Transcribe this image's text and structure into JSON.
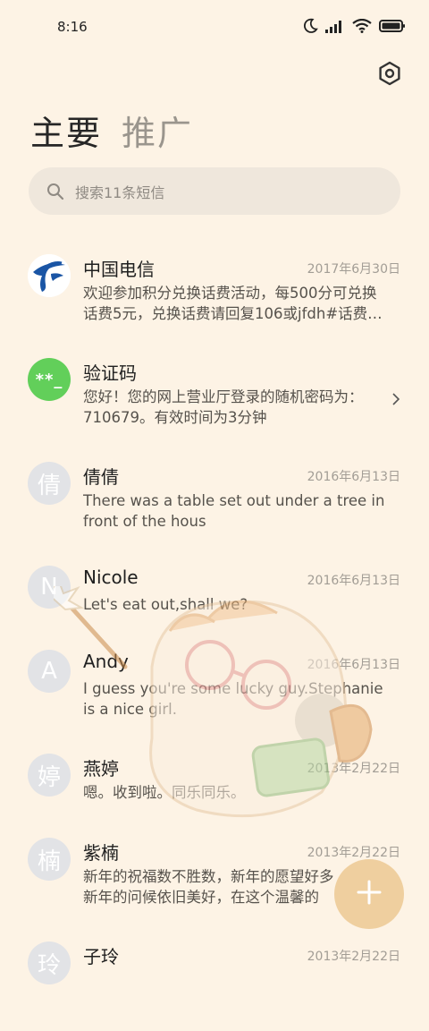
{
  "status_bar": {
    "time": "8:16",
    "icons": [
      "moon-icon",
      "signal-icon",
      "wifi-icon",
      "battery-icon"
    ]
  },
  "header": {
    "settings_icon": "settings-icon",
    "tabs": [
      {
        "label": "主要",
        "active": true
      },
      {
        "label": "推广",
        "active": false
      }
    ]
  },
  "search": {
    "placeholder": "搜索11条短信",
    "icon": "search-icon"
  },
  "conversations": [
    {
      "name": "中国电信",
      "date": "2017年6月30日",
      "message": "欢迎参加积分兑换话费活动，每500分可兑换\n话费5元，兑换话费请回复106或jfdh#话费…",
      "avatar": "telecom-logo"
    },
    {
      "name": "验证码",
      "date": "",
      "message": "您好！您的网上营业厅登录的随机密码为：\n710679。有效时间为3分钟",
      "avatar_text": "**_",
      "has_chevron": true
    },
    {
      "name": "倩倩",
      "date": "2016年6月13日",
      "message": "There was a table set out under a tree in\nfront of the hous",
      "avatar_text": "倩"
    },
    {
      "name": "Nicole",
      "date": "2016年6月13日",
      "message": "Let's eat out,shall we?",
      "avatar_text": "N"
    },
    {
      "name": "Andy",
      "date": "2016年6月13日",
      "message": "I guess you're some lucky guy.Stephanie\nis a nice girl.",
      "avatar_text": "A"
    },
    {
      "name": "燕婷",
      "date": "2013年2月22日",
      "message": "嗯。收到啦。同乐同乐。",
      "avatar_text": "婷"
    },
    {
      "name": "紫楠",
      "date": "2013年2月22日",
      "message": "新年的祝福数不胜数，新年的愿望好多\n新年的问候依旧美好，在这个温馨的",
      "avatar_text": "楠"
    },
    {
      "name": "子玲",
      "date": "2013年2月22日",
      "message": "",
      "avatar_text": "玲"
    }
  ],
  "fab": {
    "icon": "plus-icon"
  },
  "colors": {
    "background": "#fdf3e5",
    "search_bg": "#efe7dc",
    "fab": "#efcf9f",
    "code_avatar": "#62cf5a",
    "letter_avatar": "#e2e3e6",
    "telecom_blue": "#1a55a5"
  }
}
